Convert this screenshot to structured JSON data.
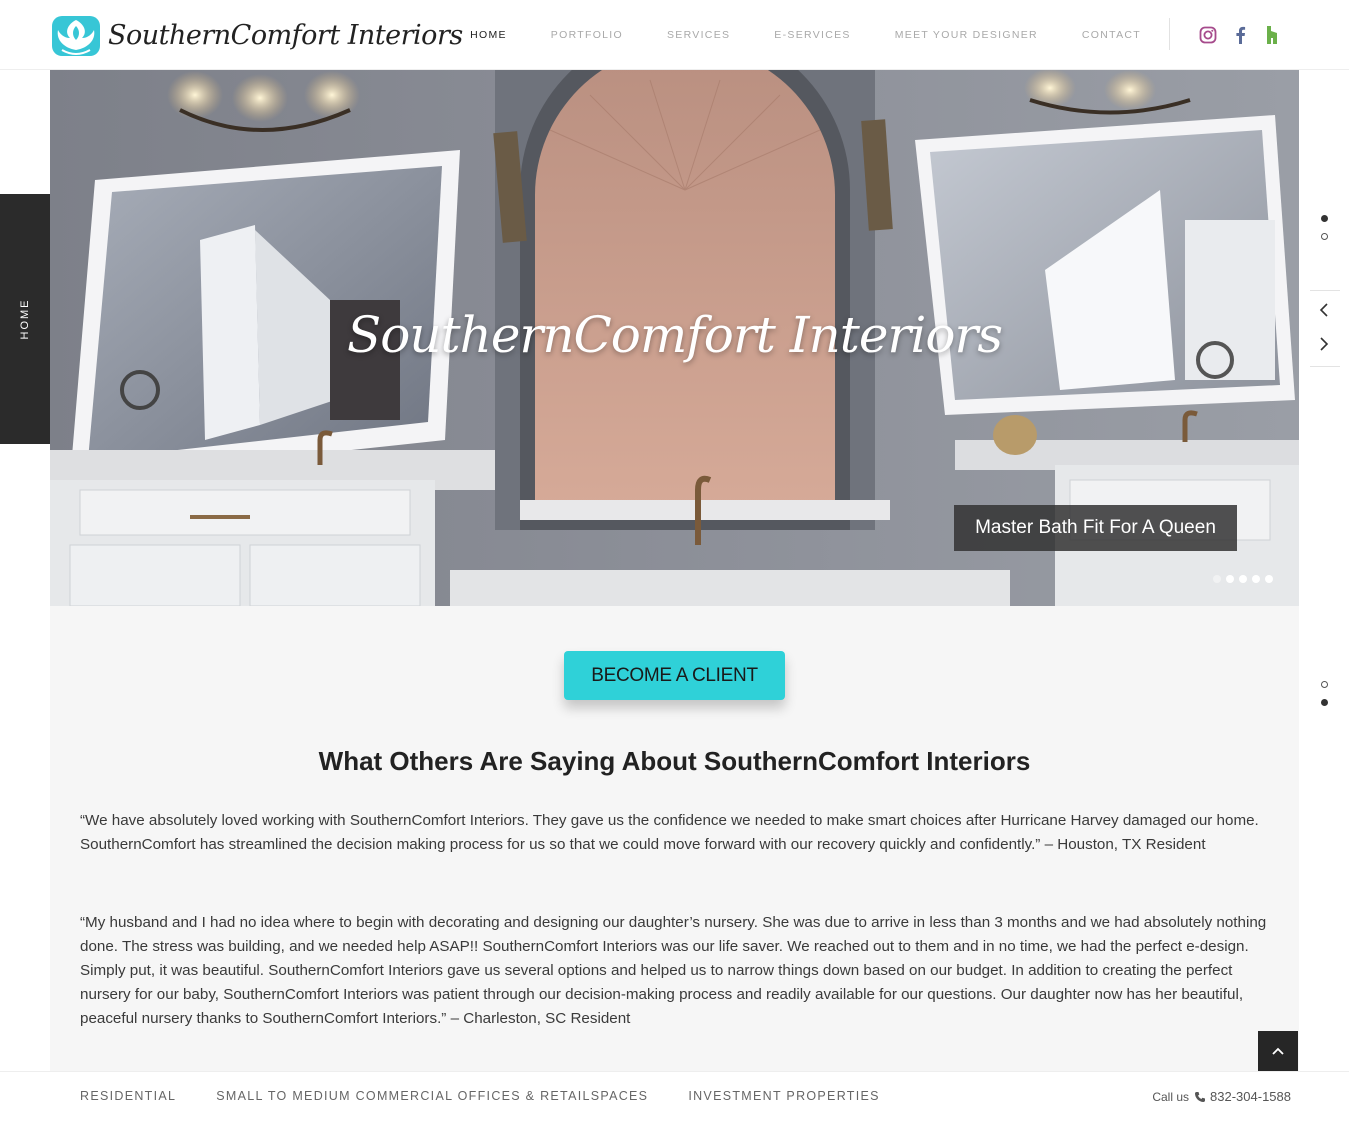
{
  "brand": {
    "logo_text": "SouthernComfort Interiors",
    "accent_color": "#2fd1d8"
  },
  "nav": {
    "items": [
      "HOME",
      "PORTFOLIO",
      "SERVICES",
      "E-SERVICES",
      "MEET YOUR DESIGNER",
      "CONTACT"
    ],
    "active": "HOME"
  },
  "social": [
    "instagram-icon",
    "facebook-icon",
    "houzz-icon"
  ],
  "side_tab": {
    "label": "HOME"
  },
  "hero": {
    "title": "SouthernComfort Interiors",
    "caption": "Master Bath Fit For A Queen",
    "slide_count": 5,
    "active_slide": 1
  },
  "content": {
    "cta_label": "BECOME A CLIENT",
    "section_title": "What Others Are Saying About SouthernComfort Interiors",
    "testimonials": [
      "“We have absolutely loved working with SouthernComfort Interiors. They gave us the confidence we needed to make smart choices after Hurricane Harvey damaged our home. SouthernComfort has streamlined the decision making process for us so that we could move forward with our recovery quickly and confidently.” – Houston, TX Resident",
      "“My husband and I had no idea where to begin with decorating and designing our daughter’s nursery. She was due to arrive in less than 3 months and we had absolutely nothing done. The stress was building, and we needed help ASAP!! SouthernComfort Interiors was our life saver. We reached out to them and in no time, we had the perfect e-design. Simply put, it was beautiful. SouthernComfort Interiors gave us several options and helped us to narrow things down based on our budget. In addition to creating the perfect nursery for our baby, SouthernComfort Interiors was patient through our decision-making process and readily available for our questions. Our daughter now has her beautiful, peaceful nursery thanks to SouthernComfort Interiors.” – Charleston, SC Resident"
    ]
  },
  "footer": {
    "links": [
      "RESIDENTIAL",
      "SMALL TO MEDIUM COMMERCIAL OFFICES & RETAILSPACES",
      "INVESTMENT PROPERTIES"
    ],
    "call_label": "Call us",
    "phone": "832-304-1588"
  }
}
